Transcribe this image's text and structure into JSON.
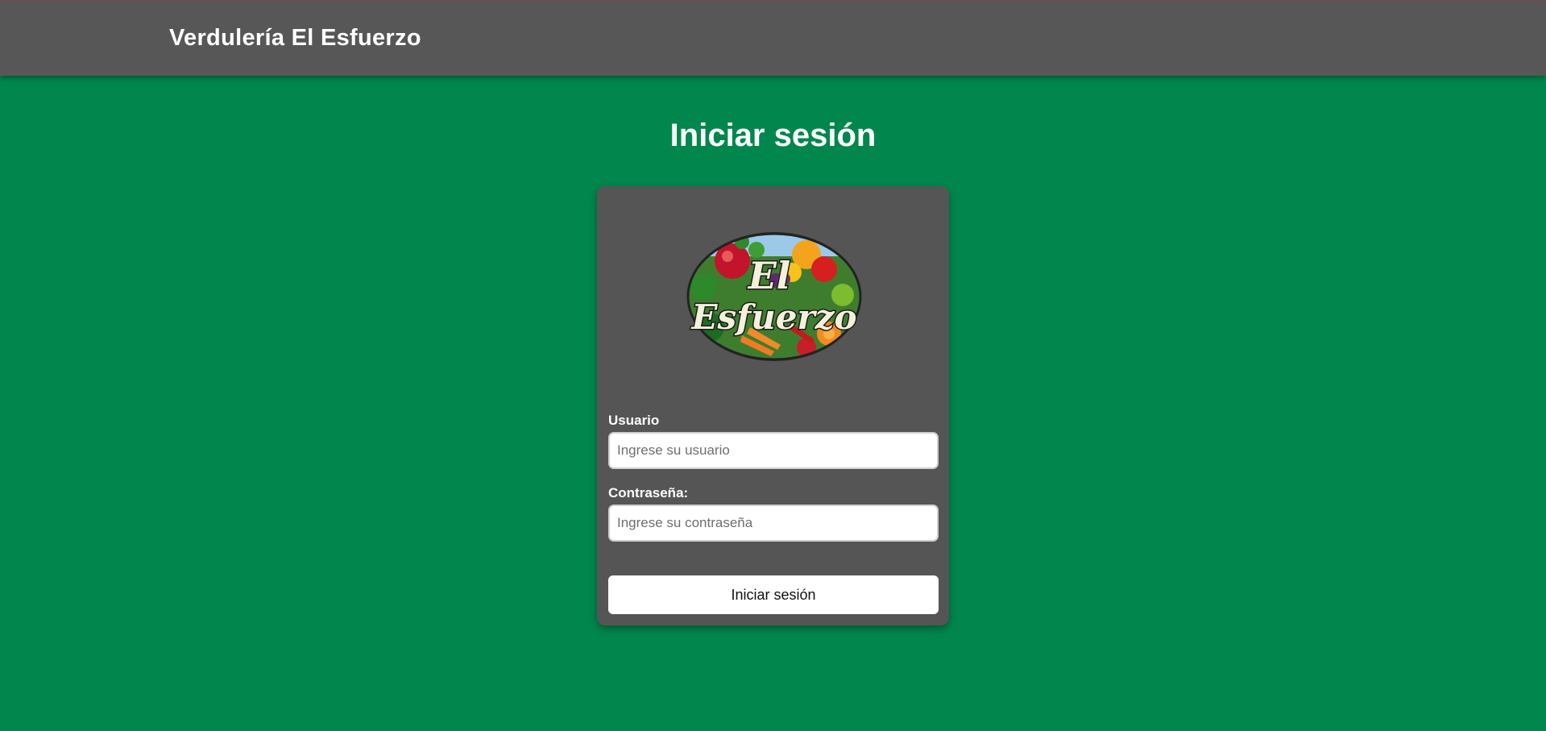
{
  "header": {
    "brand": "Verdulería El Esfuerzo"
  },
  "main": {
    "title": "Iniciar sesión"
  },
  "logo": {
    "line1": "El",
    "line2": "Esfuerzo"
  },
  "form": {
    "user_label": "Usuario",
    "user_placeholder": "Ingrese su usuario",
    "user_value": "",
    "password_label": "Contraseña:",
    "password_placeholder": "Ingrese su contraseña",
    "password_value": "",
    "submit_label": "Iniciar sesión"
  },
  "colors": {
    "background": "#01874d",
    "header": "#575757",
    "card": "#555555"
  }
}
